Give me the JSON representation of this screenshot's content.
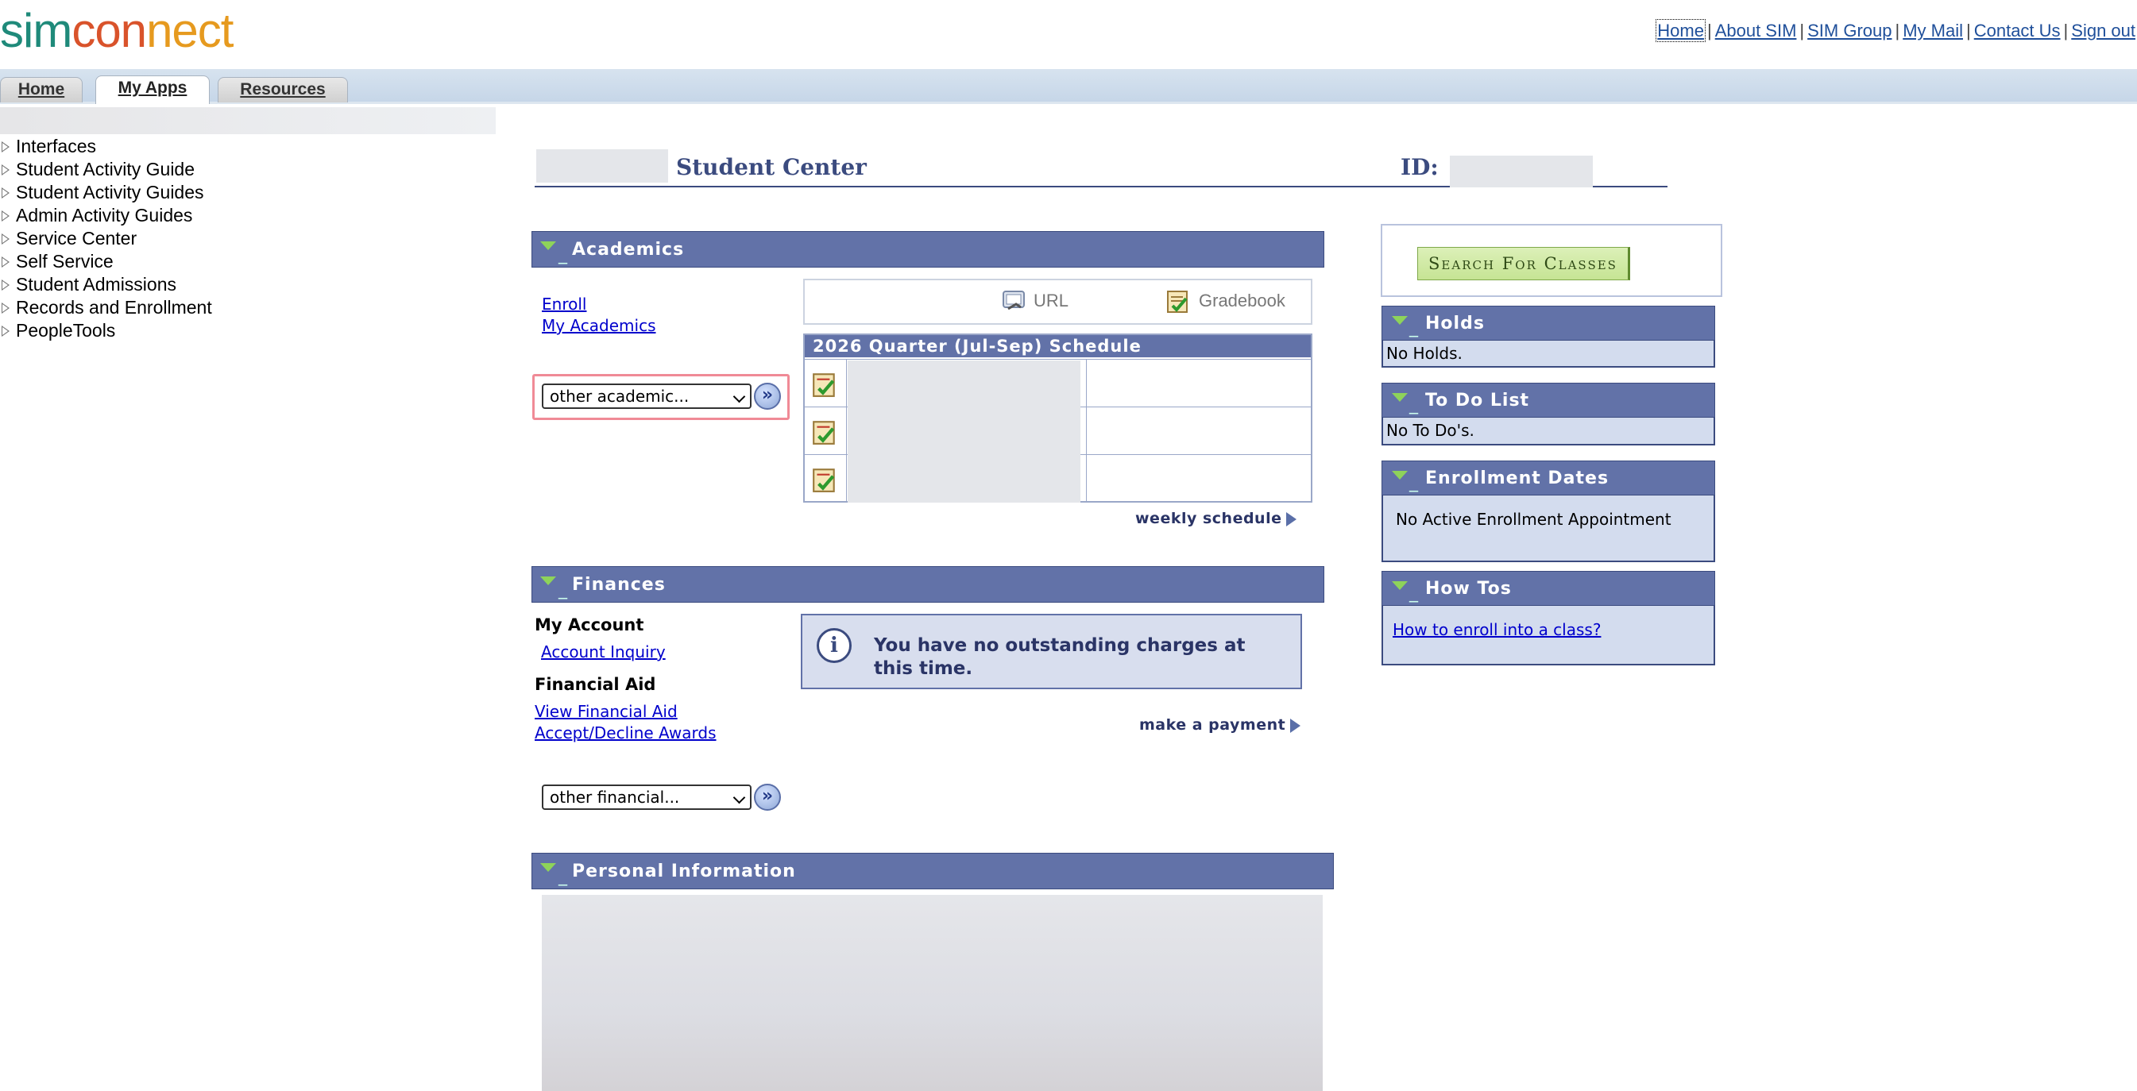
{
  "header": {
    "logo_text": "simconnect",
    "top_links": [
      "Home",
      "About SIM",
      "SIM Group",
      "My Mail",
      "Contact Us",
      "Sign out"
    ]
  },
  "tabs": [
    "Home",
    "My Apps",
    "Resources"
  ],
  "active_tab": "My Apps",
  "nav": {
    "items": [
      "Interfaces",
      "Student Activity Guide",
      "Student Activity Guides",
      "Admin Activity Guides",
      "Service Center",
      "Self Service",
      "Student Admissions",
      "Records and Enrollment",
      "PeopleTools"
    ]
  },
  "page": {
    "title": "Student Center",
    "id_label": "ID:"
  },
  "academics": {
    "header": "Academics",
    "links": [
      "Enroll",
      "My Academics"
    ],
    "select_value": "other academic...",
    "go_label": "»",
    "url_label": "URL",
    "gradebook_label": "Gradebook",
    "schedule_title": "2026 Quarter (Jul-Sep) Schedule",
    "weekly_schedule": "weekly schedule"
  },
  "finances": {
    "header": "Finances",
    "my_account": "My Account",
    "account_inquiry": "Account Inquiry",
    "financial_aid": "Financial Aid",
    "view_aid": "View Financial Aid",
    "accept_decline": "Accept/Decline Awards",
    "info_text": "You have no outstanding charges at this time.",
    "make_payment": "make a payment",
    "select_value": "other financial...",
    "go_label": "»"
  },
  "personal": {
    "header": "Personal Information"
  },
  "right": {
    "search_button": "Search For Classes",
    "holds_header": "Holds",
    "holds_text": "No Holds.",
    "todo_header": "To Do List",
    "todo_text": "No To Do's.",
    "enroll_header": "Enrollment Dates",
    "enroll_text": "No Active Enrollment Appointment",
    "howto_header": "How Tos",
    "howto_link": "How to enroll into a class?"
  },
  "colors": {
    "section_header": "#6272a8",
    "link": "#0000cc",
    "right_body": "#d3dcee",
    "search_button": "#c6e494",
    "highlight": "#f08a96"
  },
  "icons": [
    "expand-triangle-icon",
    "collapse-arrow-icon",
    "url-icon",
    "gradebook-icon",
    "schedule-check-icon",
    "info-icon",
    "go-arrow-icon",
    "right-pointer-icon"
  ]
}
